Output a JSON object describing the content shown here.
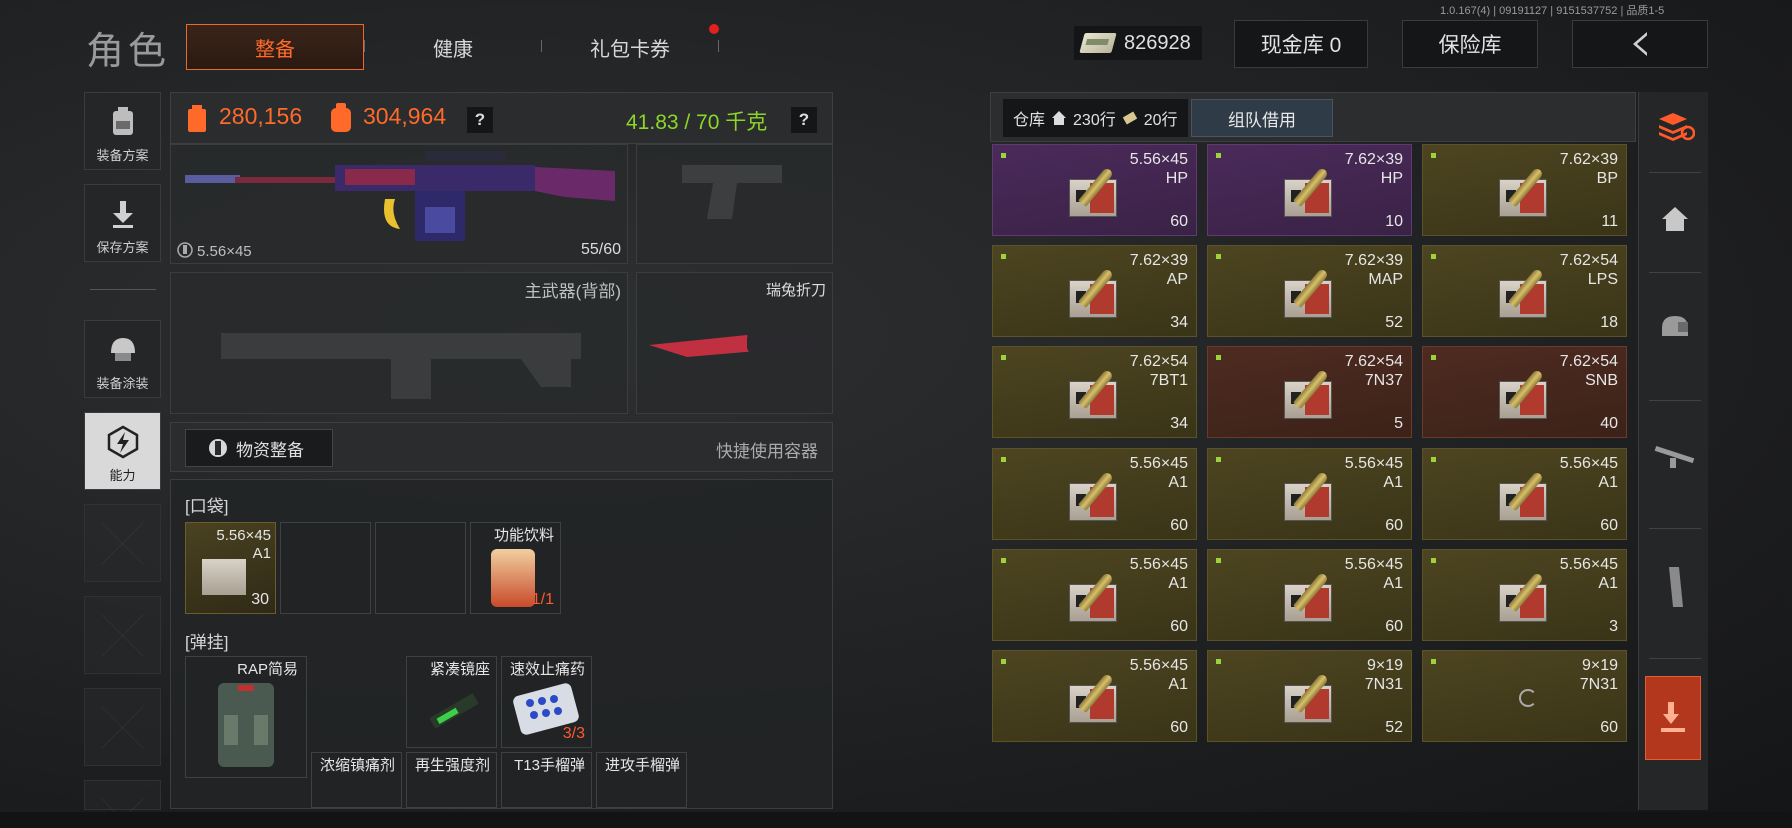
{
  "version": "1.0.167(4) | 09191127 | 9151537752 | 品质1-5",
  "header": {
    "title": "角色",
    "tabs": [
      {
        "label": "整备",
        "active": true
      },
      {
        "label": "健康",
        "active": false
      },
      {
        "label": "礼包卡券",
        "active": false,
        "badge": true
      }
    ],
    "cash": "826928",
    "cash_vault": "现金库 0",
    "safe": "保险库"
  },
  "sidebar": {
    "items": [
      {
        "label": "装备方案",
        "icon": "backpack-icon"
      },
      {
        "label": "保存方案",
        "icon": "download-icon"
      },
      {
        "label": "装备涂装",
        "icon": "helmet-icon"
      },
      {
        "label": "能力",
        "icon": "ability-icon",
        "active": true
      }
    ]
  },
  "stats": {
    "value1": "280,156",
    "value2": "304,964",
    "weight": "41.83 / 70 千克",
    "help": "?"
  },
  "weapons": {
    "primary_ammo": "5.56×45",
    "primary_count": "55/60",
    "secondary_label": "主武器(背部)",
    "knife_label": "瑞兔折刀"
  },
  "supply": {
    "button": "物资整备",
    "quick": "快捷使用容器"
  },
  "pocket": {
    "label": "[口袋]",
    "items": [
      {
        "name": "5.56×45\nA1",
        "count": "30",
        "filled": true
      },
      {
        "name": "",
        "count": ""
      },
      {
        "name": "",
        "count": ""
      },
      {
        "name": "功能饮料",
        "count": "1/1",
        "filled": true
      }
    ]
  },
  "rig": {
    "label": "[弹挂]",
    "vest": "RAP简易",
    "items": [
      {
        "name": "紧凑镜座",
        "count": ""
      },
      {
        "name": "速效止痛药",
        "count": "3/3"
      },
      {
        "name": "浓缩镇痛剂",
        "count": ""
      },
      {
        "name": "再生强度剂",
        "count": ""
      },
      {
        "name": "T13手榴弹",
        "count": ""
      },
      {
        "name": "进攻手榴弹",
        "count": ""
      }
    ]
  },
  "warehouse": {
    "label": "仓库",
    "rows": "230行",
    "tickets": "20行",
    "team_borrow": "组队借用",
    "ammo": [
      {
        "cal": "5.56×45",
        "type": "HP",
        "count": "60",
        "color": "purple"
      },
      {
        "cal": "7.62×39",
        "type": "HP",
        "count": "10",
        "color": "purple"
      },
      {
        "cal": "7.62×39",
        "type": "BP",
        "count": "11",
        "color": "gold"
      },
      {
        "cal": "7.62×39",
        "type": "AP",
        "count": "34",
        "color": "gold"
      },
      {
        "cal": "7.62×39",
        "type": "MAP",
        "count": "52",
        "color": "gold"
      },
      {
        "cal": "7.62×54",
        "type": "LPS",
        "count": "18",
        "color": "gold"
      },
      {
        "cal": "7.62×54",
        "type": "7BT1",
        "count": "34",
        "color": "gold"
      },
      {
        "cal": "7.62×54",
        "type": "7N37",
        "count": "5",
        "color": "red"
      },
      {
        "cal": "7.62×54",
        "type": "SNB",
        "count": "40",
        "color": "red"
      },
      {
        "cal": "5.56×45",
        "type": "A1",
        "count": "60",
        "color": "gold"
      },
      {
        "cal": "5.56×45",
        "type": "A1",
        "count": "60",
        "color": "gold"
      },
      {
        "cal": "5.56×45",
        "type": "A1",
        "count": "60",
        "color": "gold"
      },
      {
        "cal": "5.56×45",
        "type": "A1",
        "count": "60",
        "color": "gold"
      },
      {
        "cal": "5.56×45",
        "type": "A1",
        "count": "60",
        "color": "gold"
      },
      {
        "cal": "5.56×45",
        "type": "A1",
        "count": "3",
        "color": "gold"
      },
      {
        "cal": "5.56×45",
        "type": "A1",
        "count": "60",
        "color": "gold"
      },
      {
        "cal": "9×19",
        "type": "7N31",
        "count": "52",
        "color": "gold"
      },
      {
        "cal": "9×19",
        "type": "7N31",
        "count": "60",
        "color": "gold",
        "loading": true
      }
    ]
  },
  "right_nav": [
    "stack-icon",
    "home-icon",
    "armor-icon",
    "rifle-icon",
    "magazine-icon",
    "deposit-icon"
  ],
  "colors": {
    "accent": "#ff6a2a",
    "weight": "#8cd628",
    "purple": "#4b2a5a",
    "gold": "#4d4520",
    "red": "#4e2b20"
  }
}
